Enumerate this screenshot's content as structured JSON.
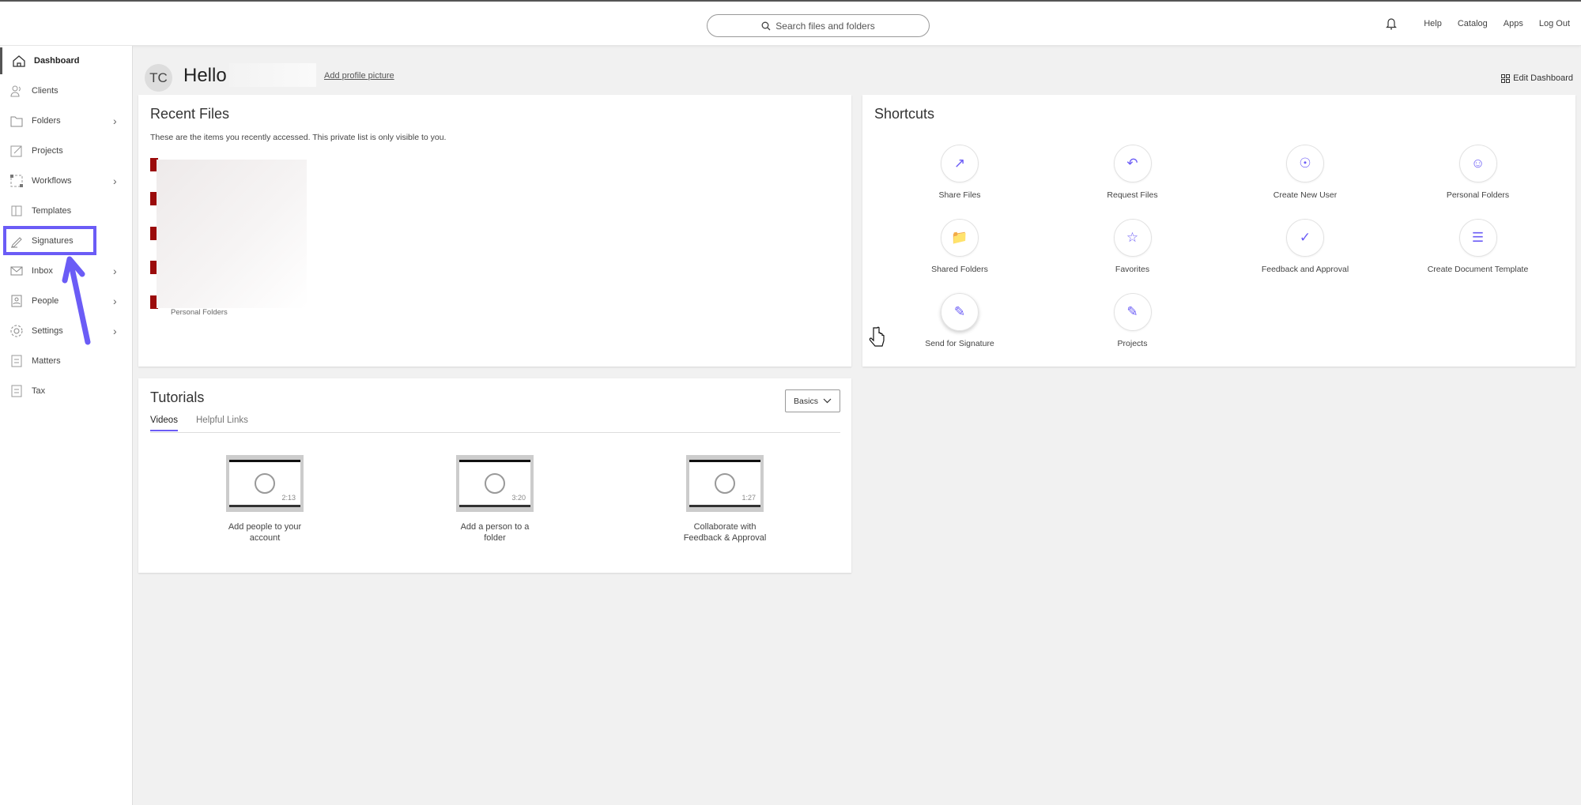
{
  "topbar": {
    "search_placeholder": "Search files and folders",
    "links": [
      "Help",
      "Catalog",
      "Apps",
      "Log Out"
    ]
  },
  "sidebar": {
    "items": [
      {
        "label": "Dashboard",
        "icon": "home-icon",
        "chev": false,
        "active": true
      },
      {
        "label": "Clients",
        "icon": "clients-icon",
        "chev": false
      },
      {
        "label": "Folders",
        "icon": "folder-icon",
        "chev": true
      },
      {
        "label": "Projects",
        "icon": "projects-icon",
        "chev": false
      },
      {
        "label": "Workflows",
        "icon": "workflows-icon",
        "chev": true
      },
      {
        "label": "Templates",
        "icon": "templates-icon",
        "chev": false
      },
      {
        "label": "Signatures",
        "icon": "pen-icon",
        "chev": false
      },
      {
        "label": "Inbox",
        "icon": "mail-icon",
        "chev": true
      },
      {
        "label": "People",
        "icon": "person-card-icon",
        "chev": true
      },
      {
        "label": "Settings",
        "icon": "gear-icon",
        "chev": true
      },
      {
        "label": "Matters",
        "icon": "matters-icon",
        "chev": false
      },
      {
        "label": "Tax",
        "icon": "tax-icon",
        "chev": false
      }
    ]
  },
  "header": {
    "initials": "TC",
    "greeting": "Hello",
    "add_picture": "Add profile picture",
    "edit_dashboard": "Edit Dashboard"
  },
  "recent": {
    "title": "Recent Files",
    "description": "These are the items you recently accessed. This private list is only visible to you.",
    "last_location": "Personal Folders"
  },
  "shortcuts": {
    "title": "Shortcuts",
    "accent": "#6b5cf6",
    "items": [
      "Share Files",
      "Request Files",
      "Create New User",
      "Personal Folders",
      "Shared Folders",
      "Favorites",
      "Feedback and Approval",
      "Create Document Template",
      "Send for Signature",
      "Projects"
    ]
  },
  "tutorials": {
    "title": "Tutorials",
    "tabs": [
      "Videos",
      "Helpful Links"
    ],
    "active_tab": "Videos",
    "filter": "Basics",
    "videos": [
      {
        "title": "Add people to your account",
        "duration": "2:13"
      },
      {
        "title": "Add a person to a folder",
        "duration": "3:20"
      },
      {
        "title": "Collaborate with Feedback & Approval",
        "duration": "1:27"
      }
    ]
  },
  "annotation": {
    "color": "#6b5cf6",
    "highlighted": "Signatures"
  }
}
